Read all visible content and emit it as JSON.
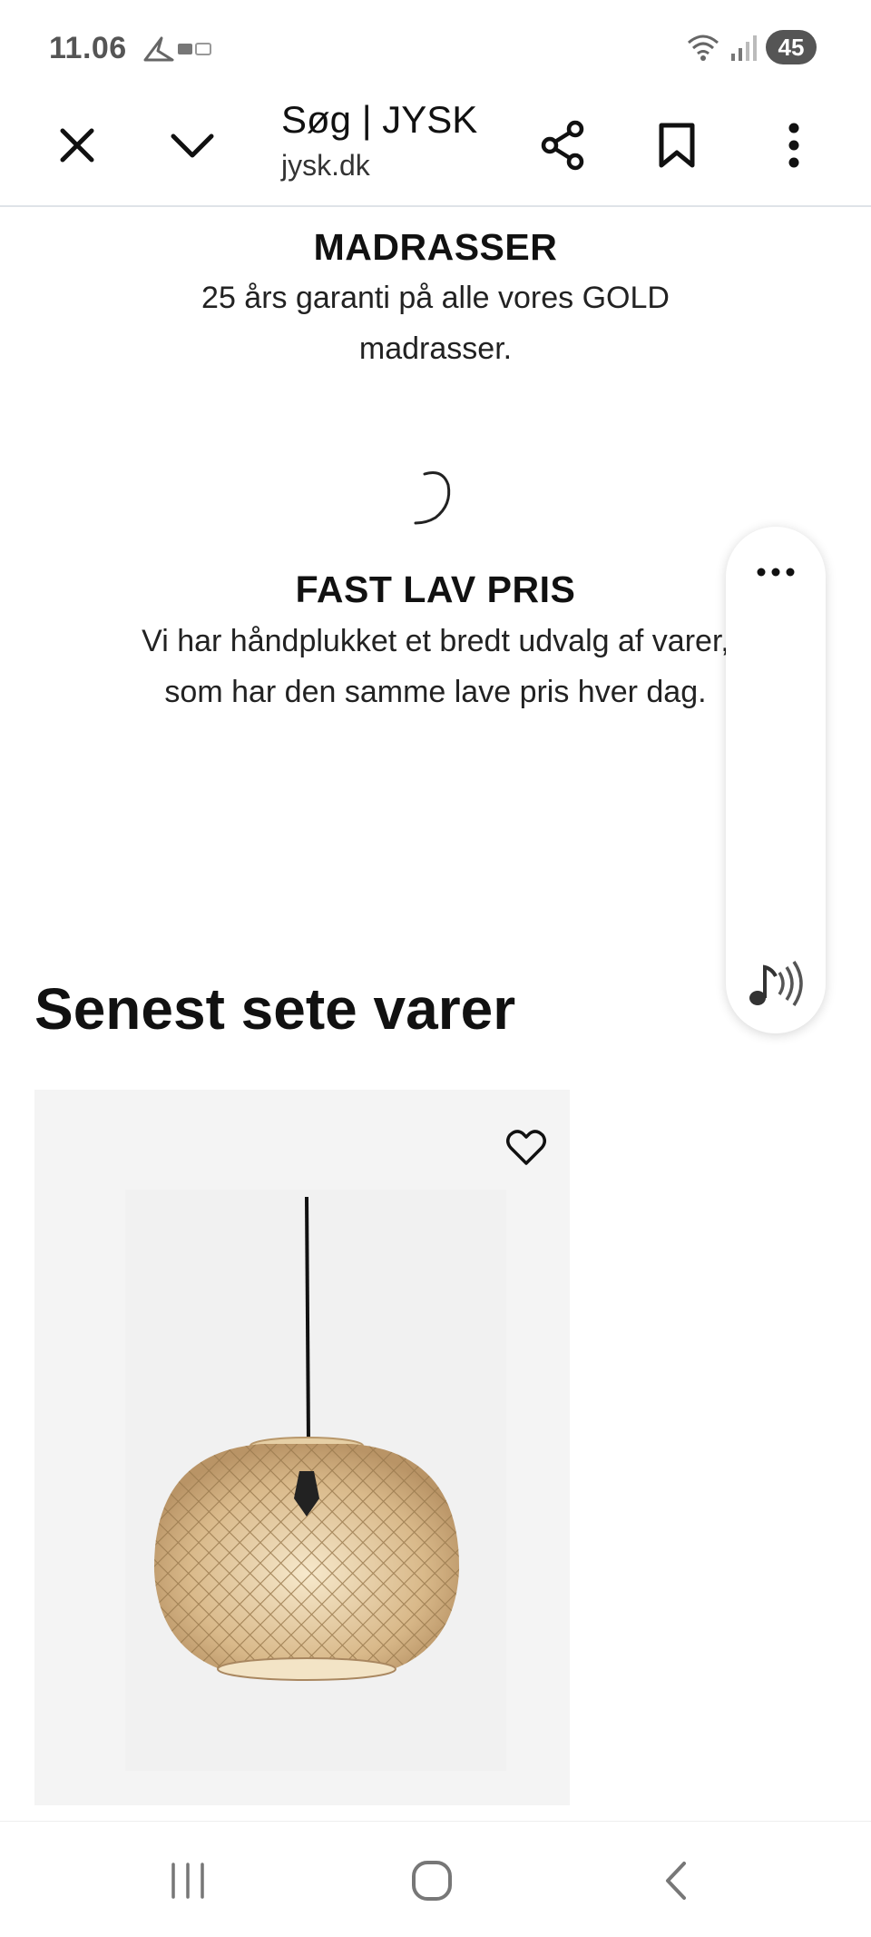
{
  "status_bar": {
    "time": "11.06",
    "battery": "45"
  },
  "browser": {
    "page_title": "Søg | JYSK",
    "url": "jysk.dk"
  },
  "content": {
    "mattress_usp": {
      "title": "MADRASSER",
      "text_line1": "25 års garanti på alle vores GOLD",
      "text_line2": "madrasser."
    },
    "price_usp": {
      "title": "FAST LAV PRIS",
      "text": "Vi har håndplukket et bredt udvalg af varer, som har den samme lave pris hver dag."
    },
    "recently_viewed": {
      "title": "Senest sete varer"
    }
  },
  "icons": {
    "close": "close-icon",
    "collapse": "chevron-down-icon",
    "share": "share-icon",
    "bookmark": "bookmark-icon",
    "menu": "more-vertical-icon",
    "favorite": "heart-icon",
    "float_more": "more-horizontal-icon",
    "audio": "read-aloud-icon",
    "nav_recents": "recents-icon",
    "nav_home": "home-icon",
    "nav_back": "back-icon"
  },
  "colors": {
    "text": "#111111",
    "status_gray": "#555555",
    "card_bg": "#f4f4f4",
    "toolbar_border": "#dfe3e8"
  }
}
